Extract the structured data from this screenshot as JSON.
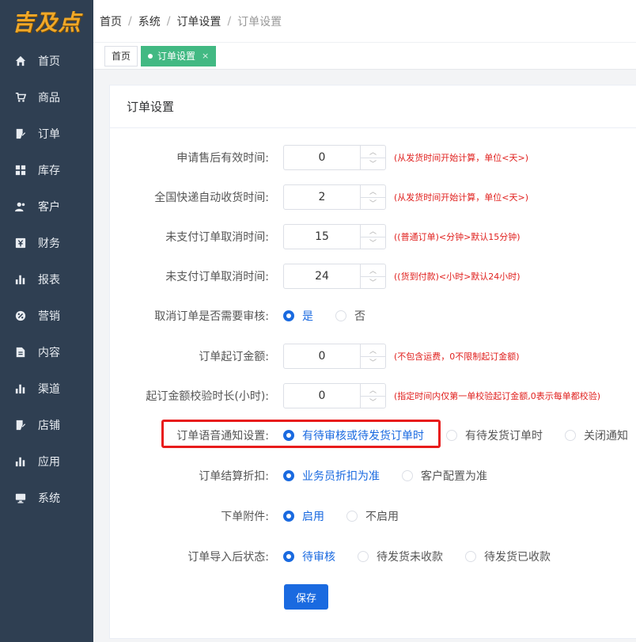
{
  "logo": {
    "text": "吉及点"
  },
  "sidebar": {
    "items": [
      {
        "label": "首页",
        "icon": "home-icon"
      },
      {
        "label": "商品",
        "icon": "cart-icon"
      },
      {
        "label": "订单",
        "icon": "order-icon"
      },
      {
        "label": "库存",
        "icon": "grid-icon"
      },
      {
        "label": "客户",
        "icon": "users-icon"
      },
      {
        "label": "财务",
        "icon": "finance-icon"
      },
      {
        "label": "报表",
        "icon": "bar-chart-icon"
      },
      {
        "label": "营销",
        "icon": "marketing-icon"
      },
      {
        "label": "内容",
        "icon": "document-icon"
      },
      {
        "label": "渠道",
        "icon": "bar-chart-icon"
      },
      {
        "label": "店铺",
        "icon": "store-icon"
      },
      {
        "label": "应用",
        "icon": "bar-chart-icon"
      },
      {
        "label": "系统",
        "icon": "monitor-icon"
      }
    ]
  },
  "breadcrumb": [
    "首页",
    "系统",
    "订单设置",
    "订单设置"
  ],
  "tabs": [
    {
      "label": "首页",
      "active": false
    },
    {
      "label": "订单设置",
      "active": true,
      "close": "×"
    }
  ],
  "card": {
    "title": "订单设置"
  },
  "form": {
    "after_sale": {
      "label": "申请售后有效时间:",
      "value": "0",
      "hint": "(从发货时间开始计算，单位<天>)"
    },
    "auto_receive": {
      "label": "全国快递自动收货时间:",
      "value": "2",
      "hint": "(从发货时间开始计算，单位<天>)"
    },
    "unpaid_cancel_1": {
      "label": "未支付订单取消时间:",
      "value": "15",
      "hint": "((普通订单)<分钟>默认15分钟)"
    },
    "unpaid_cancel_2": {
      "label": "未支付订单取消时间:",
      "value": "24",
      "hint": "((货到付款)<小时>默认24小时)"
    },
    "cancel_review": {
      "label": "取消订单是否需要审核:",
      "options": [
        "是",
        "否"
      ],
      "selected": 0
    },
    "min_amount": {
      "label": "订单起订金额:",
      "value": "0",
      "hint": "(不包含运费，0不限制起订金额)"
    },
    "min_amount_check": {
      "label": "起订金额校验时长(小时):",
      "value": "0",
      "hint": "(指定时间内仅第一单校验起订金额,0表示每单都校验)"
    },
    "voice_notify": {
      "label": "订单语音通知设置:",
      "options": [
        "有待审核或待发货订单时",
        "有待发货订单时",
        "关闭通知"
      ],
      "selected": 0
    },
    "settle_discount": {
      "label": "订单结算折扣:",
      "options": [
        "业务员折扣为准",
        "客户配置为准"
      ],
      "selected": 0
    },
    "attachment": {
      "label": "下单附件:",
      "options": [
        "启用",
        "不启用"
      ],
      "selected": 0
    },
    "import_status": {
      "label": "订单导入后状态:",
      "options": [
        "待审核",
        "待发货未收款",
        "待发货已收款"
      ],
      "selected": 0
    }
  },
  "save_label": "保存",
  "colors": {
    "sidebar_bg": "#2f3f52",
    "accent": "#1a6ae0",
    "tab_active": "#42b983",
    "hint": "#e0201e",
    "highlight": "#e81c1c"
  }
}
